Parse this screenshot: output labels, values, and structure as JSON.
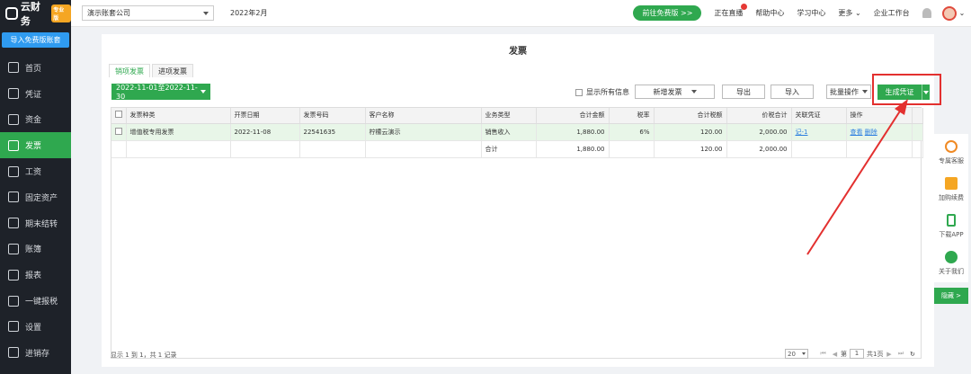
{
  "sidebar": {
    "logo": "云财务",
    "logo_tag": "专业版",
    "import_button": "导入免费版账套",
    "items": [
      {
        "label": "首页"
      },
      {
        "label": "凭证"
      },
      {
        "label": "资金"
      },
      {
        "label": "发票"
      },
      {
        "label": "工资"
      },
      {
        "label": "固定资产"
      },
      {
        "label": "期末结转"
      },
      {
        "label": "账簿"
      },
      {
        "label": "报表"
      },
      {
        "label": "一键报税"
      },
      {
        "label": "设置"
      },
      {
        "label": "进销存"
      }
    ],
    "active_index": 3
  },
  "topbar": {
    "company": "演示账套公司",
    "period": "2022年2月",
    "free_button": "前往免费版 >>",
    "links": [
      "正在直播",
      "帮助中心",
      "学习中心",
      "更多",
      "企业工作台"
    ]
  },
  "page": {
    "title": "发票",
    "tabs": [
      "销项发票",
      "进项发票"
    ],
    "date_range": "2022-11-01至2022-11-30",
    "show_all": "显示所有信息",
    "buttons": {
      "new_invoice": "新增发票",
      "export": "导出",
      "import": "导入",
      "batch": "批量操作",
      "generate": "生成凭证"
    }
  },
  "table": {
    "headers": [
      "发票种类",
      "开票日期",
      "发票号码",
      "客户名称",
      "业务类型",
      "合计金额",
      "税率",
      "合计税额",
      "价税合计",
      "关联凭证",
      "操作"
    ],
    "rows": [
      {
        "type": "增值税专用发票",
        "date": "2022-11-08",
        "number": "22541635",
        "customer": "柠檬云演示",
        "business": "销售收入",
        "amount": "1,880.00",
        "rate": "6%",
        "tax": "120.00",
        "total": "2,000.00",
        "voucher": "记-1",
        "op_view": "查看",
        "op_del": "删除"
      }
    ],
    "summary": {
      "label": "合计",
      "amount": "1,880.00",
      "tax": "120.00",
      "total": "2,000.00"
    }
  },
  "pager": {
    "info": "显示 1 到 1，共 1 记录",
    "size": "20",
    "page_prefix": "第",
    "page": "1",
    "page_suffix": "共1页"
  },
  "side_panel": {
    "items": [
      "专属客服",
      "加购续费",
      "下载APP",
      "关于我们"
    ],
    "hide": "隐藏 >"
  },
  "colors": {
    "accent": "#2fa84f",
    "sidebar": "#1e2229",
    "annotation": "#e3302f"
  }
}
